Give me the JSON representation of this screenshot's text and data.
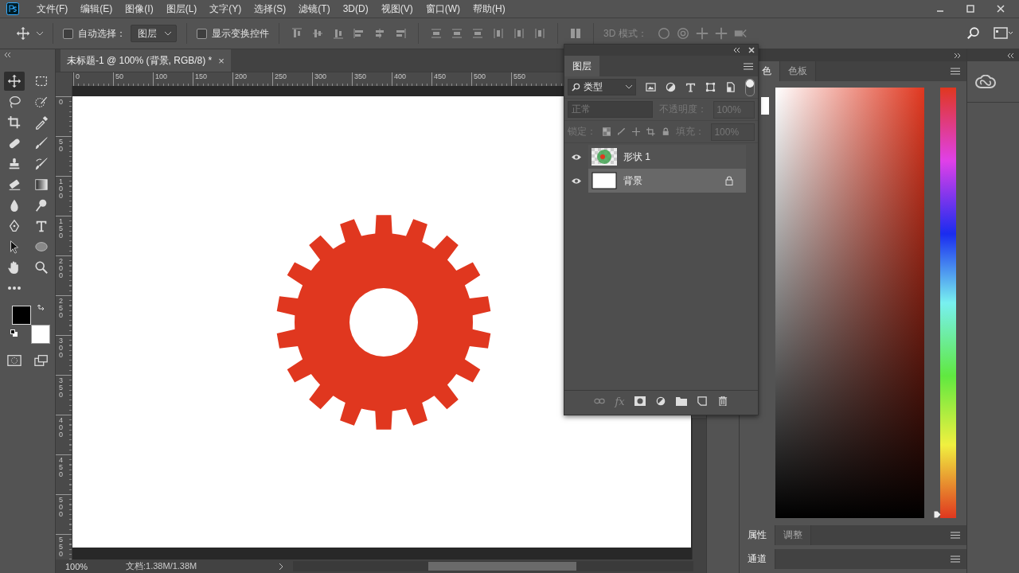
{
  "menu": [
    "文件(F)",
    "编辑(E)",
    "图像(I)",
    "图层(L)",
    "文字(Y)",
    "选择(S)",
    "滤镜(T)",
    "3D(D)",
    "视图(V)",
    "窗口(W)",
    "帮助(H)"
  ],
  "options": {
    "auto_select": {
      "label": "自动选择：",
      "checked": false
    },
    "target": "图层",
    "show_transform": {
      "label": "显示变换控件",
      "checked": false
    },
    "mode_3d": "3D 模式："
  },
  "tools": [
    {
      "kind": "move",
      "selected": true
    },
    {
      "kind": "marquee",
      "selected": false
    },
    {
      "kind": "lasso",
      "selected": false
    },
    {
      "kind": "quickselect",
      "selected": false
    },
    {
      "kind": "crop",
      "selected": false
    },
    {
      "kind": "eyedropper",
      "selected": false
    },
    {
      "kind": "healing",
      "selected": false
    },
    {
      "kind": "brush",
      "selected": false
    },
    {
      "kind": "stamp",
      "selected": false
    },
    {
      "kind": "historybrush",
      "selected": false
    },
    {
      "kind": "eraser",
      "selected": false
    },
    {
      "kind": "gradient",
      "selected": false
    },
    {
      "kind": "blur",
      "selected": false
    },
    {
      "kind": "dodge",
      "selected": false
    },
    {
      "kind": "pen",
      "selected": false
    },
    {
      "kind": "type",
      "selected": false
    },
    {
      "kind": "pathselect",
      "selected": false
    },
    {
      "kind": "ellipse",
      "selected": false
    },
    {
      "kind": "hand",
      "selected": false
    },
    {
      "kind": "zoom",
      "selected": false
    },
    {
      "kind": "more",
      "selected": false
    }
  ],
  "document_tab": {
    "title": "未标题-1 @ 100% (背景, RGB/8) *",
    "close": "×"
  },
  "ruler_h": [
    "0",
    "50",
    "100",
    "150",
    "200",
    "250",
    "300",
    "350",
    "400",
    "450",
    "500",
    "550"
  ],
  "ruler_v": [
    "0",
    "50",
    "100",
    "150",
    "200",
    "250",
    "300",
    "350",
    "400",
    "450",
    "500",
    "550"
  ],
  "status_bar": {
    "zoom": "100%",
    "document": "文档:1.38M/1.38M"
  },
  "layers_panel": {
    "title": "图层",
    "filter": "类型",
    "blend": {
      "value": "正常",
      "disabled": true
    },
    "opacity": {
      "label": "不透明度：",
      "value": "100%",
      "disabled": true
    },
    "lock_label": "锁定：",
    "fill": {
      "label": "填充：",
      "value": "100%",
      "disabled": true
    },
    "fx": "fx",
    "layers": [
      {
        "name": "形状 1",
        "kind": "shape",
        "visible": true,
        "selected": false,
        "locked": false
      },
      {
        "name": "背景",
        "kind": "background",
        "visible": true,
        "selected": true,
        "locked": true
      }
    ]
  },
  "color_panel": {
    "tabs": [
      {
        "label": "色",
        "selected": true
      },
      {
        "label": "色板",
        "selected": false
      }
    ],
    "hue": {
      "level": 0
    }
  },
  "properties_panel": {
    "tabs": [
      {
        "label": "属性",
        "selected": true
      },
      {
        "label": "调整",
        "selected": false
      }
    ]
  },
  "channels_panel": {
    "tabs": [
      {
        "label": "通道",
        "selected": true
      }
    ]
  }
}
